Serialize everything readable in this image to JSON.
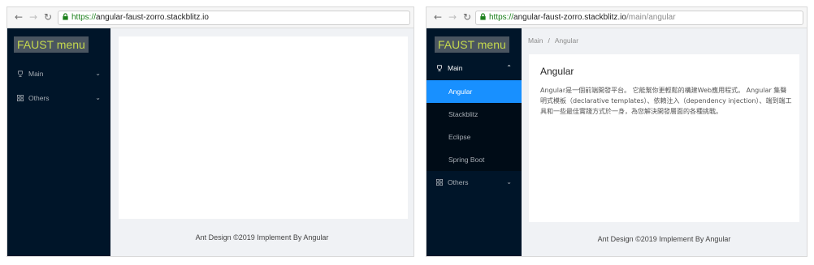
{
  "left": {
    "url": {
      "https": "https://",
      "host": "angular-faust-zorro.stackblitz.io",
      "path": ""
    },
    "logo": "FAUST menu",
    "menu": [
      {
        "label": "Main",
        "icon": "trophy-icon",
        "expanded": false
      },
      {
        "label": "Others",
        "icon": "appstore-icon",
        "expanded": false
      }
    ],
    "footer": "Ant Design ©2019 Implement By Angular"
  },
  "right": {
    "url": {
      "https": "https://",
      "host": "angular-faust-zorro.stackblitz.io",
      "path": "/main/angular"
    },
    "logo": "FAUST menu",
    "menu": {
      "main": {
        "label": "Main",
        "icon": "trophy-icon",
        "expanded": true
      },
      "sub": [
        "Angular",
        "Stackblitz",
        "Eclipse",
        "Spring Boot"
      ],
      "selected": "Angular",
      "others": {
        "label": "Others",
        "icon": "appstore-icon",
        "expanded": false
      }
    },
    "breadcrumb": [
      "Main",
      "/",
      "Angular"
    ],
    "title": "Angular",
    "description": "Angular是一個前端開發平台。 它能幫你更輕鬆的構建Web應用程式。 Angular 集聲明式模板（declarative templates）、依賴注入（dependency injection）、端到端工具和一些最佳實踐方式於一身，為您解決開發層面的各種挑戰。",
    "footer": "Ant Design ©2019 Implement By Angular"
  },
  "colors": {
    "sider": "#001529",
    "submenu": "#000c17",
    "selected": "#1890ff",
    "logo_text": "#c5d94e",
    "content": "#f0f2f5"
  }
}
